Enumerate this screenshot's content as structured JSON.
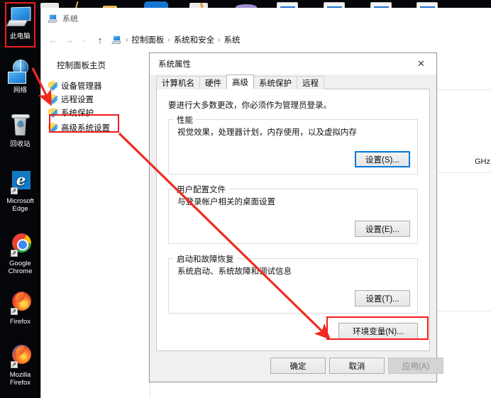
{
  "desktop": {
    "icons": [
      {
        "name": "this-pc",
        "label": "此电脑",
        "icon": "computer-icon"
      },
      {
        "name": "network",
        "label": "网络",
        "icon": "network-globe-icon"
      },
      {
        "name": "recycle-bin",
        "label": "回收站",
        "icon": "recycle-bin-icon"
      },
      {
        "name": "microsoft-edge",
        "label": "Microsoft Edge",
        "icon": "edge-icon"
      },
      {
        "name": "google-chrome",
        "label": "Google Chrome",
        "icon": "chrome-icon"
      },
      {
        "name": "firefox",
        "label": "Firefox",
        "icon": "firefox-icon"
      },
      {
        "name": "mozilla-firefox",
        "label": "Mozilla Firefox",
        "icon": "firefox-blue-icon"
      }
    ],
    "shortcut_glyph": "↗"
  },
  "explorer": {
    "title": "系统",
    "title_icon": "computer-icon",
    "nav": {
      "back": "←",
      "forward": "→",
      "recent": "⌄",
      "up": "↑"
    },
    "breadcrumb": {
      "icon": "computer-icon",
      "separator": "›",
      "crumbs": [
        "控制面板",
        "系统和安全",
        "系统"
      ]
    },
    "sidebar": {
      "home": "控制面板主页",
      "items": [
        {
          "label": "设备管理器",
          "icon": "shield-icon"
        },
        {
          "label": "远程设置",
          "icon": "shield-icon"
        },
        {
          "label": "系统保护",
          "icon": "shield-icon"
        },
        {
          "label": "高级系统设置",
          "icon": "shield-icon"
        }
      ]
    },
    "content": {
      "ghz_text": "GHz"
    }
  },
  "dialog": {
    "title": "系统属性",
    "close_icon": "close-icon",
    "tabs": [
      {
        "label": "计算机名",
        "active": false
      },
      {
        "label": "硬件",
        "active": false
      },
      {
        "label": "高级",
        "active": true
      },
      {
        "label": "系统保护",
        "active": false
      },
      {
        "label": "远程",
        "active": false
      }
    ],
    "note": "要进行大多数更改，你必须作为管理员登录。",
    "groups": [
      {
        "legend": "性能",
        "description": "视觉效果，处理器计划，内存使用，以及虚拟内存",
        "button": "设置(S)...",
        "button_focus": true
      },
      {
        "legend": "用户配置文件",
        "description": "与登录帐户相关的桌面设置",
        "button": "设置(E)...",
        "button_focus": false
      },
      {
        "legend": "启动和故障恢复",
        "description": "系统启动、系统故障和调试信息",
        "button": "设置(T)...",
        "button_focus": false
      }
    ],
    "env_button": "环境变量(N)...",
    "footer": {
      "ok": "确定",
      "cancel": "取消",
      "apply": "应用(A)",
      "apply_disabled": true
    }
  },
  "annotations": {
    "color": "#ee1c1c",
    "arrow_color": "#ee2b20",
    "boxes": [
      "this-pc-icon",
      "advanced-system-settings-link",
      "environment-variables-button"
    ],
    "arrow": {
      "from": "advanced-system-settings-link",
      "to": "environment-variables-button"
    }
  }
}
